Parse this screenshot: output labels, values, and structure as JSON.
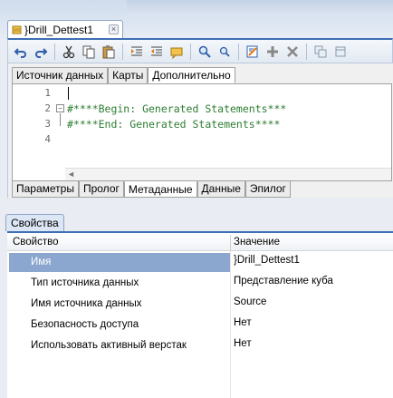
{
  "document_tab": {
    "title": "}Drill_Dettest1",
    "close": "×"
  },
  "toolbar": {
    "buttons": [
      "undo-icon",
      "redo-icon",
      "cut-icon",
      "copy-icon",
      "paste-icon",
      "indent-icon",
      "outdent-icon",
      "comment-icon",
      "find-icon",
      "find-next-icon",
      "edit-icon",
      "add-icon",
      "delete-icon",
      "duplicate-icon",
      "copy-window-icon"
    ]
  },
  "upper_tabs": [
    {
      "label": "Источник данных",
      "active": false
    },
    {
      "label": "Карты",
      "active": false
    },
    {
      "label": "Дополнительно",
      "active": true
    }
  ],
  "editor": {
    "lines": [
      {
        "no": "1",
        "text": ""
      },
      {
        "no": "2",
        "text": "#****Begin: Generated Statements***"
      },
      {
        "no": "3",
        "text": "#****End: Generated Statements****"
      },
      {
        "no": "4",
        "text": ""
      }
    ],
    "fold_symbol": "−"
  },
  "lower_tabs": [
    {
      "label": "Параметры",
      "active": false
    },
    {
      "label": "Пролог",
      "active": false
    },
    {
      "label": "Метаданные",
      "active": true
    },
    {
      "label": "Данные",
      "active": false
    },
    {
      "label": "Эпилог",
      "active": false
    }
  ],
  "properties": {
    "tab_title": "Свойства",
    "header_name": "Свойство",
    "header_value": "Значение",
    "rows": [
      {
        "name": "Имя",
        "value": "}Drill_Dettest1",
        "selected": true
      },
      {
        "name": "Тип источника данных",
        "value": "Представление куба",
        "selected": false
      },
      {
        "name": "Имя источника данных",
        "value": "Source",
        "selected": false
      },
      {
        "name": "Безопасность доступа",
        "value": "Нет",
        "selected": false
      },
      {
        "name": "Использовать активный верстак",
        "value": "Нет",
        "selected": false
      }
    ]
  },
  "colors": {
    "accent": "#3f6fb5",
    "code_green": "#2e7d32",
    "selection": "#8ba7cf"
  }
}
